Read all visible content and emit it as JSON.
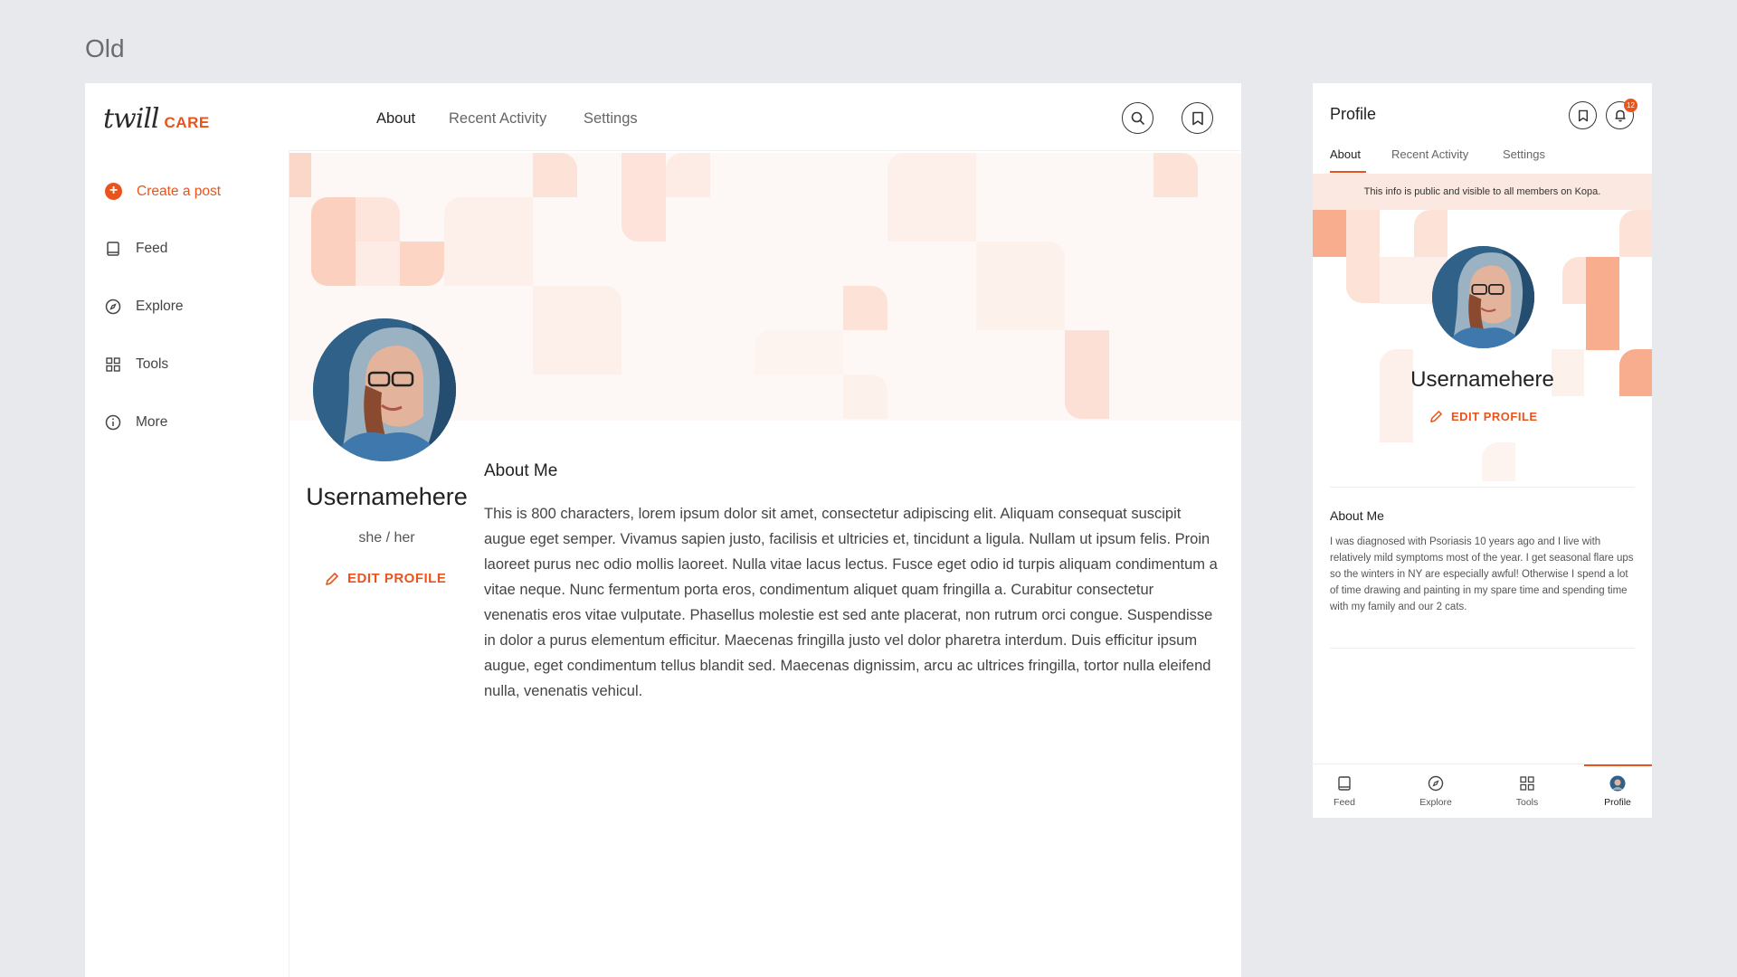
{
  "page_label": "Old",
  "brand": {
    "logo_word": "twill",
    "logo_suffix": "CARE",
    "accent": "#e8541c"
  },
  "sidebar": {
    "items": [
      {
        "label": "Create a post",
        "icon": "plus-circle-icon"
      },
      {
        "label": "Feed",
        "icon": "book-icon"
      },
      {
        "label": "Explore",
        "icon": "compass-icon"
      },
      {
        "label": "Tools",
        "icon": "grid-icon"
      },
      {
        "label": "More",
        "icon": "info-icon"
      }
    ]
  },
  "desktop": {
    "tabs": [
      {
        "label": "About",
        "active": true
      },
      {
        "label": "Recent Activity",
        "active": false
      },
      {
        "label": "Settings",
        "active": false
      }
    ],
    "profile": {
      "username": "Usernamehere",
      "pronouns": "she / her",
      "edit_label": "EDIT PROFILE"
    },
    "about": {
      "title": "About Me",
      "text": "This is 800 characters, lorem ipsum dolor sit amet, consectetur adipiscing elit. Aliquam consequat suscipit augue eget semper. Vivamus sapien justo, facilisis et ultricies et, tincidunt a ligula. Nullam ut ipsum felis. Proin laoreet purus nec odio mollis laoreet. Nulla vitae lacus lectus. Fusce eget odio id turpis aliquam condimentum a vitae neque. Nunc fermentum porta eros, condimentum aliquet quam fringilla a. Curabitur consectetur venenatis eros vitae vulputate. Phasellus molestie est sed ante placerat, non rutrum orci congue. Suspendisse in dolor a purus elementum efficitur. Maecenas fringilla justo vel dolor pharetra interdum. Duis efficitur ipsum augue, eget condimentum tellus blandit sed. Maecenas dignissim, arcu ac ultrices fringilla, tortor nulla eleifend nulla, venenatis vehicul."
    }
  },
  "mobile": {
    "title": "Profile",
    "notification_count": "12",
    "tabs": [
      {
        "label": "About",
        "active": true
      },
      {
        "label": "Recent Activity",
        "active": false
      },
      {
        "label": "Settings",
        "active": false
      }
    ],
    "notice": "This info is public and visible to all members on Kopa.",
    "username": "Usernamehere",
    "edit_label": "EDIT PROFILE",
    "about_title": "About Me",
    "about_text": "I was diagnosed with Psoriasis 10 years ago and I live with relatively mild symptoms most of the year. I get seasonal flare ups so the winters in NY are especially awful! Otherwise I spend a lot of time drawing and painting in my spare time and spending time with my family and our 2 cats.",
    "nav": [
      {
        "label": "Feed",
        "icon": "book-icon"
      },
      {
        "label": "Explore",
        "icon": "compass-icon"
      },
      {
        "label": "Tools",
        "icon": "grid-icon"
      },
      {
        "label": "Profile",
        "icon": "avatar-icon",
        "active": true
      }
    ]
  }
}
